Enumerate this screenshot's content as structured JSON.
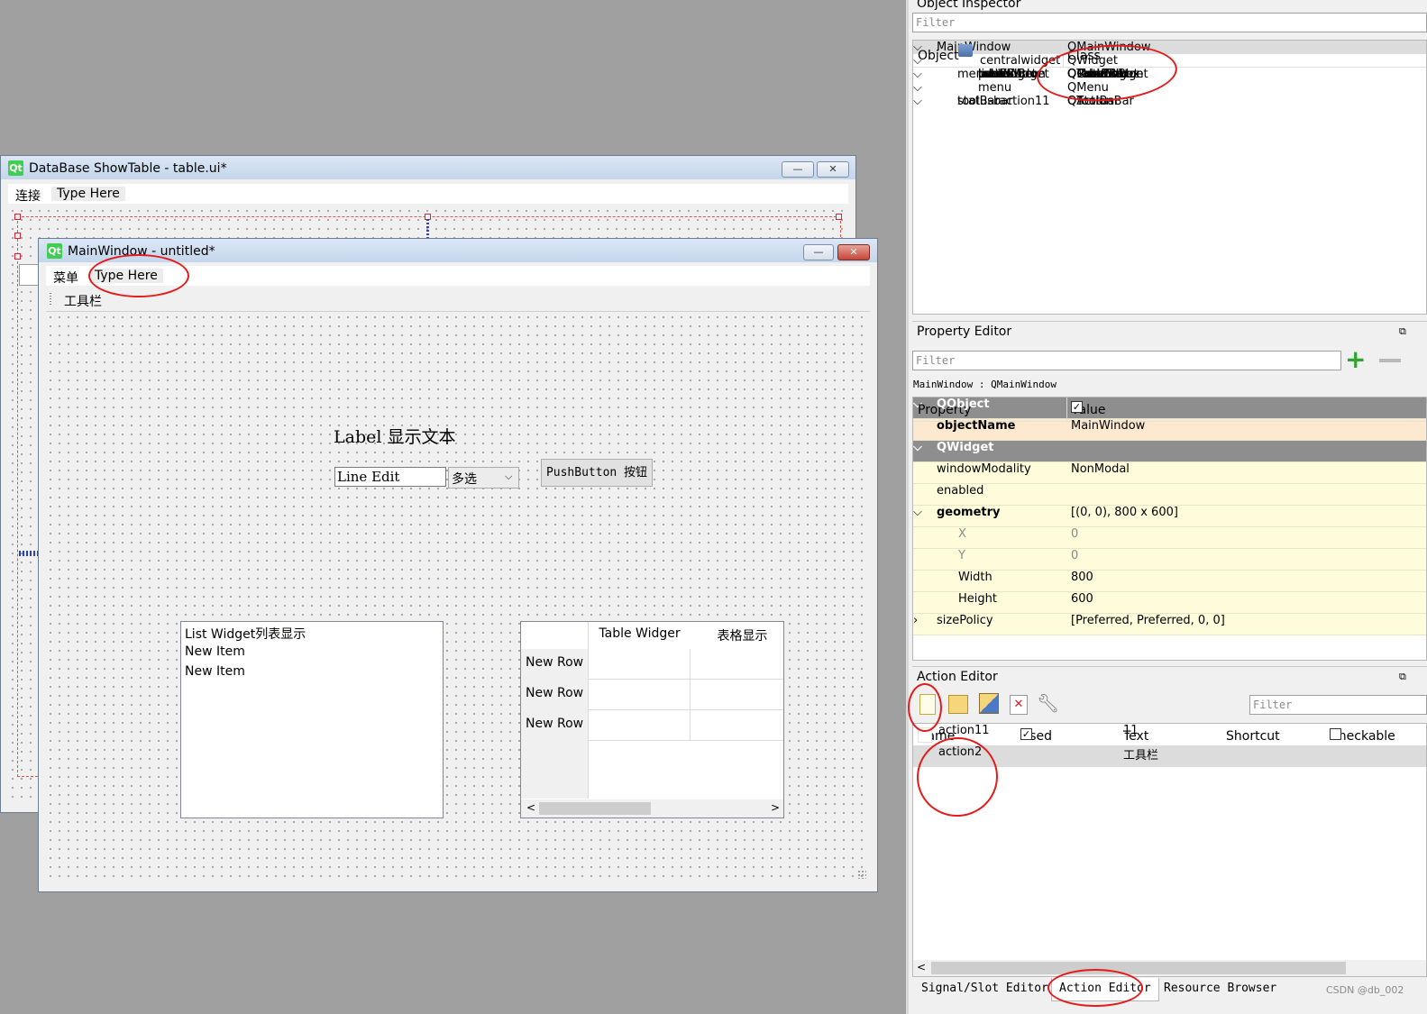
{
  "back_window": {
    "title": "DataBase ShowTable - table.ui*",
    "logo": "Qt",
    "menu": [
      "连接",
      "Type Here"
    ]
  },
  "front_window": {
    "title": "MainWindow - untitled*",
    "logo": "Qt",
    "menu": [
      "菜单",
      "Type Here"
    ],
    "toolbar_item": "工具栏",
    "label_text": "Label 显示文本",
    "line_edit_value": "Line Edit",
    "combo_value": "多选",
    "push_button": "PushButton 按钮",
    "list_widget_items": [
      "List Widget列表显示",
      "New Item",
      "New Item"
    ],
    "table_widget": {
      "columns": [
        "Table Widger",
        "表格显示"
      ],
      "rows": [
        "New Row",
        "New Row",
        "New Row"
      ]
    }
  },
  "object_inspector": {
    "title": "Object Inspector",
    "filter_placeholder": "Filter",
    "headers": [
      "Object",
      "Class"
    ],
    "rows": [
      {
        "object": "MainWindow",
        "class": "QMainWindow"
      },
      {
        "object": "centralwidget",
        "class": "QWidget"
      },
      {
        "object": "comboBox",
        "class": "QComboBox"
      },
      {
        "object": "label",
        "class": "QLabel"
      },
      {
        "object": "lineEdit",
        "class": "QLineEdit"
      },
      {
        "object": "listWidget",
        "class": "QListWidget"
      },
      {
        "object": "pushButton",
        "class": "QPushButton"
      },
      {
        "object": "tableWidget",
        "class": "QTableWidget"
      },
      {
        "object": "menubar",
        "class": "QMenuBar"
      },
      {
        "object": "menu",
        "class": "QMenu"
      },
      {
        "object": "action11",
        "class": "QAction"
      },
      {
        "object": "statusbar",
        "class": "QStatusBar"
      },
      {
        "object": "toolBar",
        "class": "QToolBar"
      }
    ]
  },
  "property_editor": {
    "title": "Property Editor",
    "filter_placeholder": "Filter",
    "context": "MainWindow : QMainWindow",
    "headers": [
      "Property",
      "Value"
    ],
    "rows": [
      {
        "property": "QObject",
        "value": ""
      },
      {
        "property": "objectName",
        "value": "MainWindow"
      },
      {
        "property": "QWidget",
        "value": ""
      },
      {
        "property": "windowModality",
        "value": "NonModal"
      },
      {
        "property": "enabled",
        "value": ""
      },
      {
        "property": "geometry",
        "value": "[(0, 0), 800 x 600]"
      },
      {
        "property": "X",
        "value": "0"
      },
      {
        "property": "Y",
        "value": "0"
      },
      {
        "property": "Width",
        "value": "800"
      },
      {
        "property": "Height",
        "value": "600"
      },
      {
        "property": "sizePolicy",
        "value": "[Preferred, Preferred, 0, 0]"
      }
    ]
  },
  "action_editor": {
    "title": "Action Editor",
    "filter_placeholder": "Filter",
    "headers": [
      "Name",
      "Used",
      "Text",
      "Shortcut",
      "Checkable"
    ],
    "rows": [
      {
        "name": "action11",
        "text": "11"
      },
      {
        "name": "action2",
        "text": "工具栏"
      }
    ]
  },
  "bottom_tabs": [
    "Signal/Slot Editor",
    "Action Editor",
    "Resource Browser"
  ],
  "watermark": "CSDN @db_002",
  "colors": {
    "annotation_red": "#e41b1b",
    "category_row": "#8e8e8e",
    "property_yellow": "#fffcdb",
    "selected_row": "#dcdcdc"
  },
  "icons": [
    "qt-logo",
    "minimize-icon",
    "close-icon",
    "add-property-icon",
    "remove-property-icon",
    "wrench-icon",
    "new-action-icon",
    "open-icon",
    "copy-icon",
    "delete-icon",
    "chevron-down-icon",
    "chevron-right-icon"
  ]
}
